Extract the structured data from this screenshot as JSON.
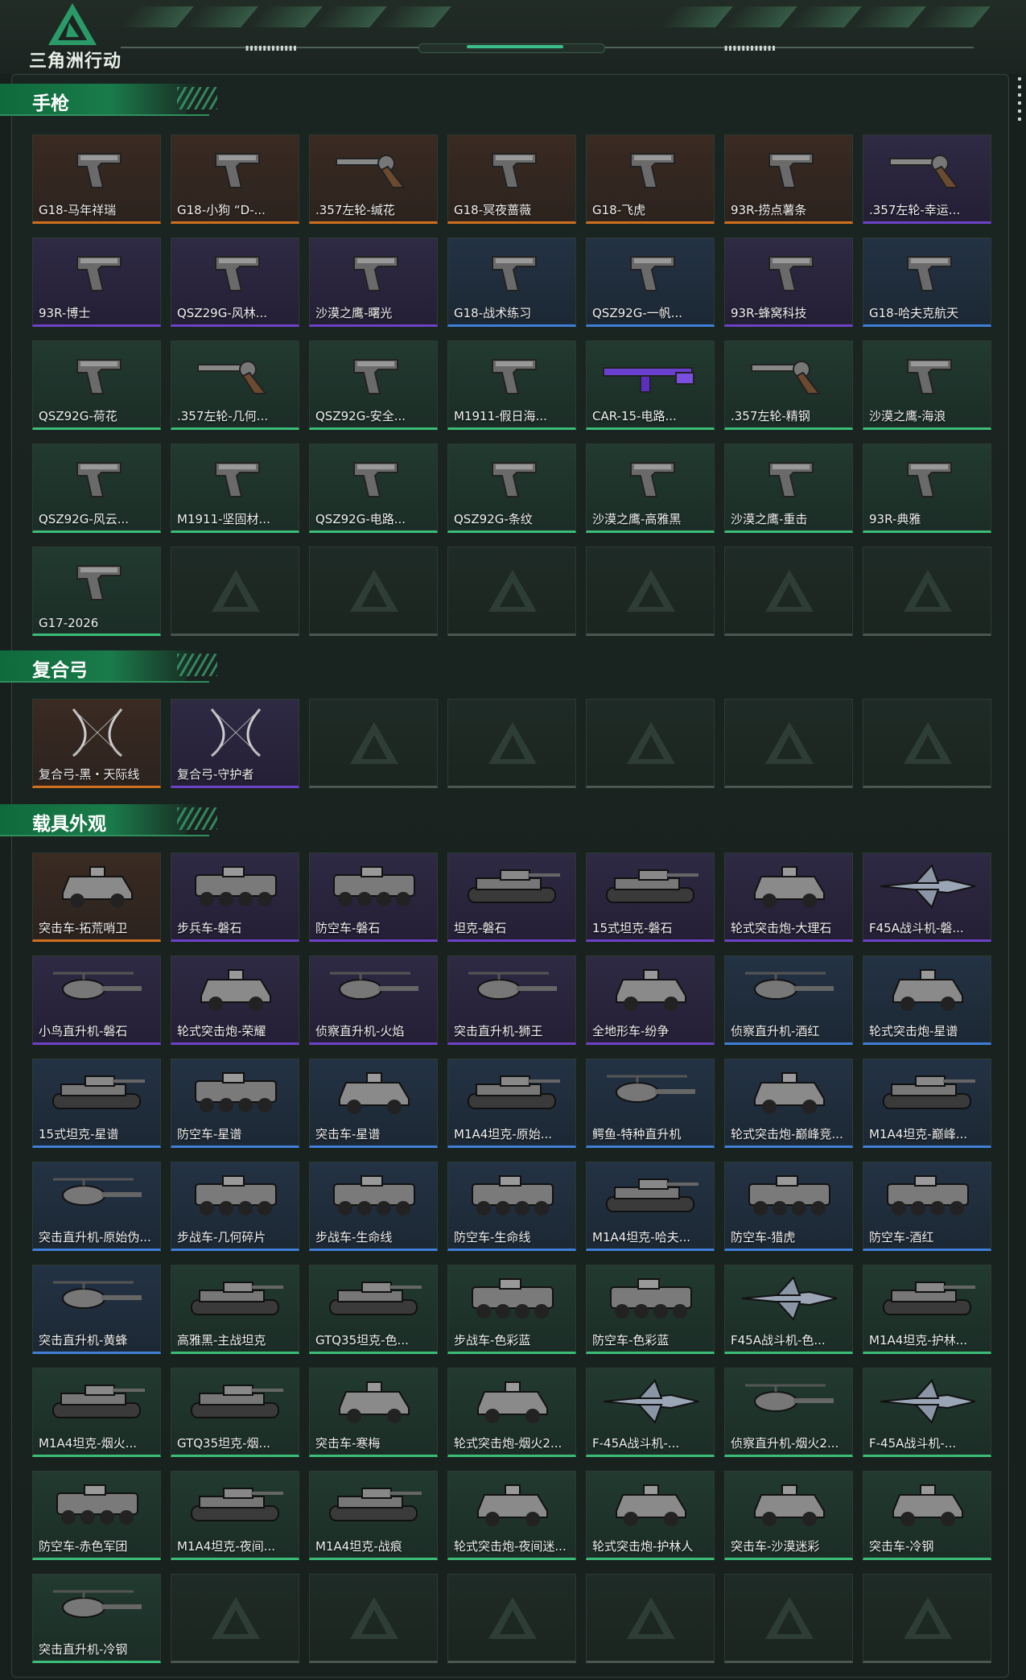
{
  "app": {
    "logo_text": "三角洲行动",
    "accent_color": "#1a7b4a"
  },
  "sections": [
    {
      "title": "手枪",
      "items": [
        {
          "label": "G18-马年祥瑞",
          "rarity": "orange",
          "icon": "pistol"
        },
        {
          "label": "G18-小狗 “D-...",
          "rarity": "orange",
          "icon": "pistol"
        },
        {
          "label": ".357左轮-缄花",
          "rarity": "orange",
          "icon": "revolver"
        },
        {
          "label": "G18-冥夜蔷薇",
          "rarity": "orange",
          "icon": "pistol"
        },
        {
          "label": "G18-飞虎",
          "rarity": "orange",
          "icon": "pistol"
        },
        {
          "label": "93R-捞点薯条",
          "rarity": "orange",
          "icon": "pistol"
        },
        {
          "label": ".357左轮-幸运...",
          "rarity": "purple",
          "icon": "revolver"
        },
        {
          "label": "93R-博士",
          "rarity": "purple",
          "icon": "pistol"
        },
        {
          "label": "QSZ29G-风林...",
          "rarity": "purple",
          "icon": "pistol"
        },
        {
          "label": "沙漠之鹰-曙光",
          "rarity": "purple",
          "icon": "pistol"
        },
        {
          "label": "G18-战术练习",
          "rarity": "blue",
          "icon": "pistol"
        },
        {
          "label": "QSZ92G-一帆...",
          "rarity": "blue",
          "icon": "pistol"
        },
        {
          "label": "93R-蜂窝科技",
          "rarity": "purple",
          "icon": "pistol"
        },
        {
          "label": "G18-哈夫克航天",
          "rarity": "blue",
          "icon": "pistol"
        },
        {
          "label": "QSZ92G-荷花",
          "rarity": "green",
          "icon": "pistol"
        },
        {
          "label": ".357左轮-几何...",
          "rarity": "green",
          "icon": "revolver"
        },
        {
          "label": "QSZ92G-安全...",
          "rarity": "green",
          "icon": "pistol"
        },
        {
          "label": "M1911-假日海...",
          "rarity": "green",
          "icon": "pistol"
        },
        {
          "label": "CAR-15-电路...",
          "rarity": "green",
          "icon": "rifle"
        },
        {
          "label": ".357左轮-精钢",
          "rarity": "green",
          "icon": "revolver"
        },
        {
          "label": "沙漠之鹰-海浪",
          "rarity": "green",
          "icon": "pistol"
        },
        {
          "label": "QSZ92G-风云...",
          "rarity": "green",
          "icon": "pistol"
        },
        {
          "label": "M1911-坚固材...",
          "rarity": "green",
          "icon": "pistol"
        },
        {
          "label": "QSZ92G-电路...",
          "rarity": "green",
          "icon": "pistol"
        },
        {
          "label": "QSZ92G-条纹",
          "rarity": "green",
          "icon": "pistol"
        },
        {
          "label": "沙漠之鹰-高雅黑",
          "rarity": "green",
          "icon": "pistol"
        },
        {
          "label": "沙漠之鹰-重击",
          "rarity": "green",
          "icon": "pistol"
        },
        {
          "label": "93R-典雅",
          "rarity": "green",
          "icon": "pistol"
        },
        {
          "label": "G17-2026",
          "rarity": "green",
          "icon": "pistol"
        }
      ]
    },
    {
      "title": "复合弓",
      "items": [
        {
          "label": "复合弓-黑・天际线",
          "rarity": "orange",
          "icon": "bow"
        },
        {
          "label": "复合弓-守护者",
          "rarity": "purple",
          "icon": "bow"
        }
      ]
    },
    {
      "title": "载具外观",
      "items": [
        {
          "label": "突击车-拓荒哨卫",
          "rarity": "orange",
          "icon": "car"
        },
        {
          "label": "步兵车-磐石",
          "rarity": "purple",
          "icon": "apc"
        },
        {
          "label": "防空车-磐石",
          "rarity": "purple",
          "icon": "apc"
        },
        {
          "label": "坦克-磐石",
          "rarity": "purple",
          "icon": "tank"
        },
        {
          "label": "15式坦克-磐石",
          "rarity": "purple",
          "icon": "tank"
        },
        {
          "label": "轮式突击炮-大理石",
          "rarity": "purple",
          "icon": "car"
        },
        {
          "label": "F45A战斗机-磐...",
          "rarity": "purple",
          "icon": "jet"
        },
        {
          "label": "小鸟直升机-磐石",
          "rarity": "purple",
          "icon": "heli"
        },
        {
          "label": "轮式突击炮-荣耀",
          "rarity": "purple",
          "icon": "car"
        },
        {
          "label": "侦察直升机-火焰",
          "rarity": "purple",
          "icon": "heli"
        },
        {
          "label": "突击直升机-狮王",
          "rarity": "purple",
          "icon": "heli"
        },
        {
          "label": "全地形车-纷争",
          "rarity": "purple",
          "icon": "car"
        },
        {
          "label": "侦察直升机-酒红",
          "rarity": "blue",
          "icon": "heli"
        },
        {
          "label": "轮式突击炮-星谱",
          "rarity": "blue",
          "icon": "car"
        },
        {
          "label": "15式坦克-星谱",
          "rarity": "blue",
          "icon": "tank"
        },
        {
          "label": "防空车-星谱",
          "rarity": "blue",
          "icon": "apc"
        },
        {
          "label": "突击车-星谱",
          "rarity": "blue",
          "icon": "car"
        },
        {
          "label": "M1A4坦克-原始...",
          "rarity": "blue",
          "icon": "tank"
        },
        {
          "label": "鳄鱼-特种直升机",
          "rarity": "blue",
          "icon": "heli"
        },
        {
          "label": "轮式突击炮-巅峰竞...",
          "rarity": "blue",
          "icon": "car"
        },
        {
          "label": "M1A4坦克-巅峰...",
          "rarity": "blue",
          "icon": "tank"
        },
        {
          "label": "突击直升机-原始伪...",
          "rarity": "blue",
          "icon": "heli"
        },
        {
          "label": "步战车-几何碎片",
          "rarity": "blue",
          "icon": "apc"
        },
        {
          "label": "步战车-生命线",
          "rarity": "blue",
          "icon": "apc"
        },
        {
          "label": "防空车-生命线",
          "rarity": "blue",
          "icon": "apc"
        },
        {
          "label": "M1A4坦克-哈夫...",
          "rarity": "blue",
          "icon": "tank"
        },
        {
          "label": "防空车-猎虎",
          "rarity": "blue",
          "icon": "apc"
        },
        {
          "label": "防空车-酒红",
          "rarity": "blue",
          "icon": "apc"
        },
        {
          "label": "突击直升机-黄蜂",
          "rarity": "blue",
          "icon": "heli"
        },
        {
          "label": "高雅黑-主战坦克",
          "rarity": "green",
          "icon": "tank"
        },
        {
          "label": "GTQ35坦克-色...",
          "rarity": "green",
          "icon": "tank"
        },
        {
          "label": "步战车-色彩蓝",
          "rarity": "green",
          "icon": "apc"
        },
        {
          "label": "防空车-色彩蓝",
          "rarity": "green",
          "icon": "apc"
        },
        {
          "label": "F45A战斗机-色...",
          "rarity": "green",
          "icon": "jet"
        },
        {
          "label": "M1A4坦克-护林...",
          "rarity": "green",
          "icon": "tank"
        },
        {
          "label": "M1A4坦克-烟火...",
          "rarity": "green",
          "icon": "tank"
        },
        {
          "label": "GTQ35坦克-烟...",
          "rarity": "green",
          "icon": "tank"
        },
        {
          "label": "突击车-寒梅",
          "rarity": "green",
          "icon": "car"
        },
        {
          "label": "轮式突击炮-烟火2...",
          "rarity": "green",
          "icon": "car"
        },
        {
          "label": "F-45A战斗机-...",
          "rarity": "green",
          "icon": "jet"
        },
        {
          "label": "侦察直升机-烟火2...",
          "rarity": "green",
          "icon": "heli"
        },
        {
          "label": "F-45A战斗机-...",
          "rarity": "green",
          "icon": "jet"
        },
        {
          "label": "防空车-赤色军团",
          "rarity": "green",
          "icon": "apc"
        },
        {
          "label": "M1A4坦克-夜间...",
          "rarity": "green",
          "icon": "tank"
        },
        {
          "label": "M1A4坦克-战痕",
          "rarity": "green",
          "icon": "tank"
        },
        {
          "label": "轮式突击炮-夜间迷...",
          "rarity": "green",
          "icon": "car"
        },
        {
          "label": "轮式突击炮-护林人",
          "rarity": "green",
          "icon": "car"
        },
        {
          "label": "突击车-沙漠迷彩",
          "rarity": "green",
          "icon": "car"
        },
        {
          "label": "突击车-冷钢",
          "rarity": "green",
          "icon": "car"
        },
        {
          "label": "突击直升机-冷钢",
          "rarity": "green",
          "icon": "heli"
        }
      ]
    }
  ]
}
